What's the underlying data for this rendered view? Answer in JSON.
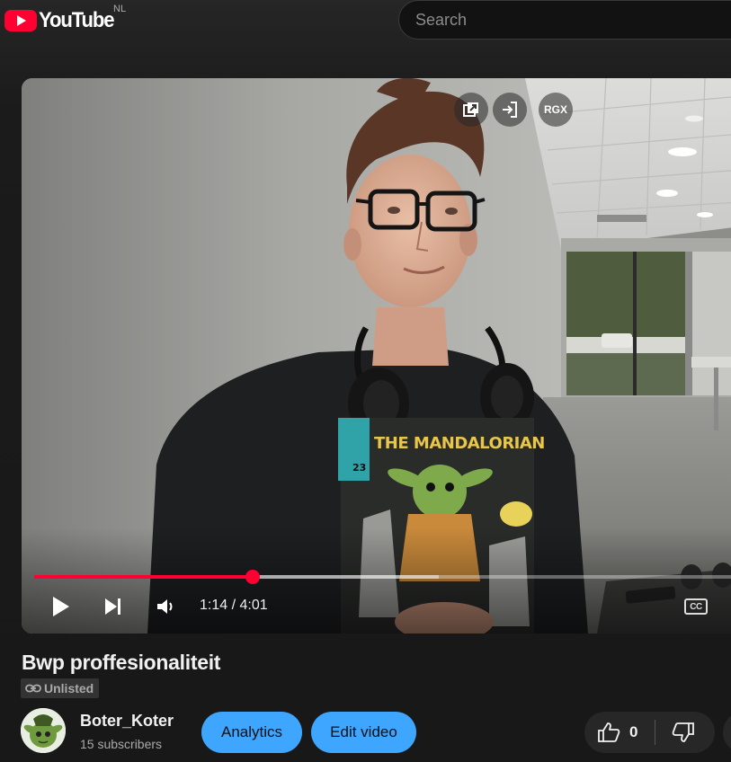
{
  "header": {
    "logo_text": "YouTube",
    "country_code": "NL",
    "search_placeholder": "Search"
  },
  "player": {
    "top_buttons": {
      "rgx_label": "RGX"
    },
    "time_current": "1:14",
    "time_total": "4:01",
    "time_display": "1:14 / 4:01",
    "progress_fraction": 0.307,
    "buffered_fraction": 0.57,
    "cc_label": "CC",
    "shirt_text": "THE MANDALORIAN"
  },
  "video": {
    "title": "Bwp proffesionaliteit",
    "visibility": "Unlisted"
  },
  "channel": {
    "name": "Boter_Koter",
    "subscribers": "15 subscribers"
  },
  "actions": {
    "analytics_label": "Analytics",
    "edit_label": "Edit video",
    "like_count": "0"
  },
  "colors": {
    "brand_red": "#ff0033",
    "action_blue": "#3ea6ff",
    "background": "#181818"
  }
}
